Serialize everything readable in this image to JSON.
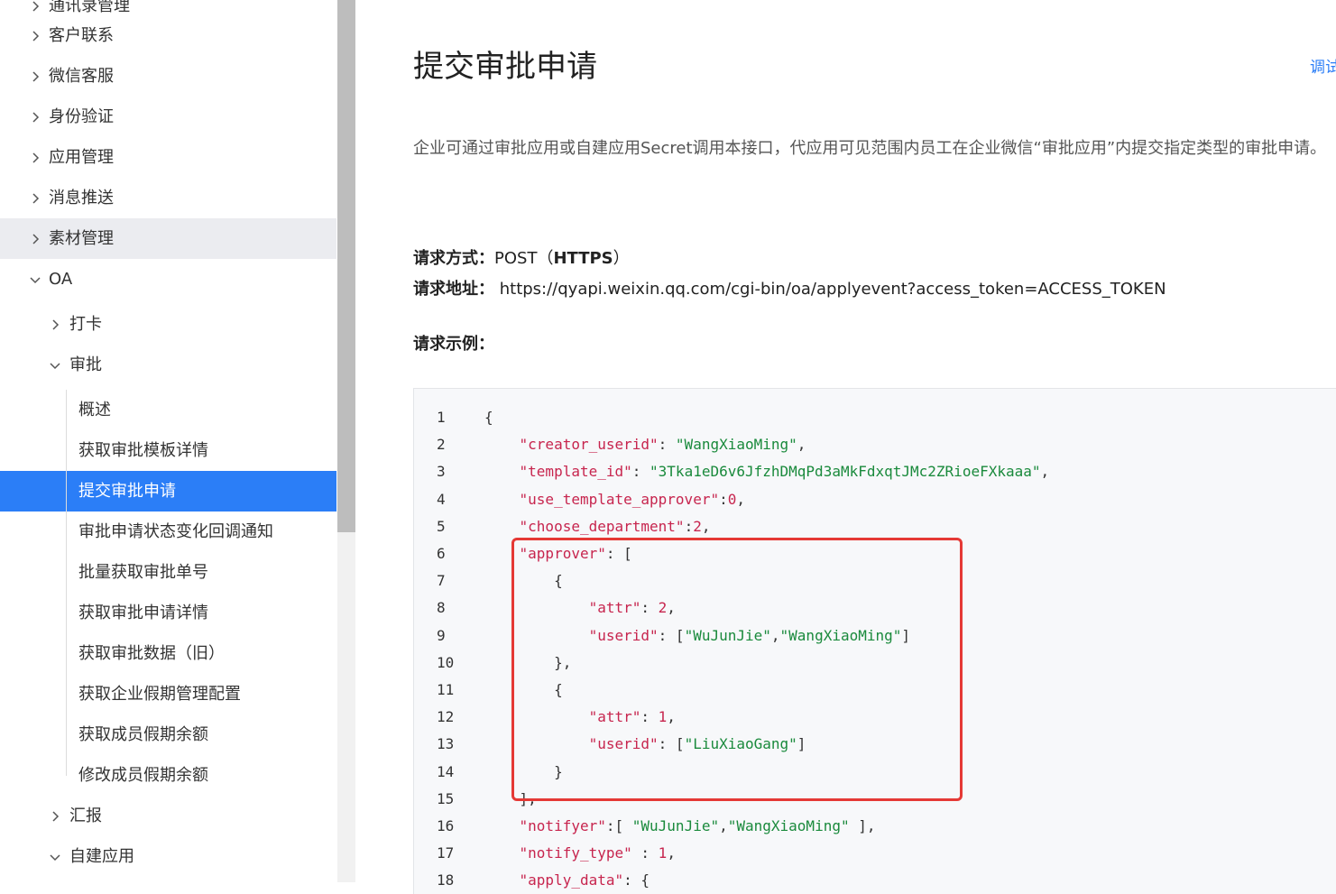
{
  "sidebar": {
    "items": [
      {
        "label": "通讯录管理",
        "level": 1,
        "state": "collapsed"
      },
      {
        "label": "客户联系",
        "level": 1,
        "state": "collapsed"
      },
      {
        "label": "微信客服",
        "level": 1,
        "state": "collapsed"
      },
      {
        "label": "身份验证",
        "level": 1,
        "state": "collapsed"
      },
      {
        "label": "应用管理",
        "level": 1,
        "state": "collapsed"
      },
      {
        "label": "消息推送",
        "level": 1,
        "state": "collapsed"
      },
      {
        "label": "素材管理",
        "level": 1,
        "state": "collapsed"
      },
      {
        "label": "OA",
        "level": 1,
        "state": "expanded"
      },
      {
        "label": "打卡",
        "level": 2,
        "state": "collapsed"
      },
      {
        "label": "审批",
        "level": 2,
        "state": "expanded"
      },
      {
        "label": "概述",
        "level": 3
      },
      {
        "label": "获取审批模板详情",
        "level": 3
      },
      {
        "label": "提交审批申请",
        "level": 3,
        "active": true
      },
      {
        "label": "审批申请状态变化回调通知",
        "level": 3
      },
      {
        "label": "批量获取审批单号",
        "level": 3
      },
      {
        "label": "获取审批申请详情",
        "level": 3
      },
      {
        "label": "获取审批数据（旧）",
        "level": 3
      },
      {
        "label": "获取企业假期管理配置",
        "level": 3
      },
      {
        "label": "获取成员假期余额",
        "level": 3
      },
      {
        "label": "修改成员假期余额",
        "level": 3
      },
      {
        "label": "汇报",
        "level": 2,
        "state": "collapsed"
      },
      {
        "label": "自建应用",
        "level": 2,
        "state": "expanded"
      }
    ]
  },
  "main": {
    "title": "提交审批申请",
    "debug_link": "调试",
    "description": "企业可通过审批应用或自建应用Secret调用本接口，代应用可见范围内员工在企业微信“审批应用”内提交指定类型的审批申请。",
    "method_label": "请求方式：",
    "method_value": "POST（",
    "method_https": "HTTPS",
    "method_close": "）",
    "url_label": "请求地址：",
    "url_value": " https://qyapi.weixin.qq.com/cgi-bin/oa/applyevent?access_token=ACCESS_TOKEN",
    "example_label": "请求示例："
  },
  "code": {
    "lines": [
      {
        "n": "1",
        "segs": [
          {
            "t": "{",
            "c": "p"
          }
        ]
      },
      {
        "n": "2",
        "segs": [
          {
            "t": "    ",
            "c": "p"
          },
          {
            "t": "\"creator_userid\"",
            "c": "k"
          },
          {
            "t": ": ",
            "c": "p"
          },
          {
            "t": "\"WangXiaoMing\"",
            "c": "s"
          },
          {
            "t": ",",
            "c": "p"
          }
        ]
      },
      {
        "n": "3",
        "segs": [
          {
            "t": "    ",
            "c": "p"
          },
          {
            "t": "\"template_id\"",
            "c": "k"
          },
          {
            "t": ": ",
            "c": "p"
          },
          {
            "t": "\"3Tka1eD6v6JfzhDMqPd3aMkFdxqtJMc2ZRioeFXkaaa\"",
            "c": "s"
          },
          {
            "t": ",",
            "c": "p"
          }
        ]
      },
      {
        "n": "4",
        "segs": [
          {
            "t": "    ",
            "c": "p"
          },
          {
            "t": "\"use_template_approver\"",
            "c": "k"
          },
          {
            "t": ":",
            "c": "p"
          },
          {
            "t": "0",
            "c": "n"
          },
          {
            "t": ",",
            "c": "p"
          }
        ]
      },
      {
        "n": "5",
        "segs": [
          {
            "t": "    ",
            "c": "p"
          },
          {
            "t": "\"choose_department\"",
            "c": "k"
          },
          {
            "t": ":",
            "c": "p"
          },
          {
            "t": "2",
            "c": "n"
          },
          {
            "t": ",",
            "c": "p"
          }
        ]
      },
      {
        "n": "6",
        "segs": [
          {
            "t": "    ",
            "c": "p"
          },
          {
            "t": "\"approver\"",
            "c": "k"
          },
          {
            "t": ": [",
            "c": "p"
          }
        ]
      },
      {
        "n": "7",
        "segs": [
          {
            "t": "        {",
            "c": "p"
          }
        ]
      },
      {
        "n": "8",
        "segs": [
          {
            "t": "            ",
            "c": "p"
          },
          {
            "t": "\"attr\"",
            "c": "k"
          },
          {
            "t": ": ",
            "c": "p"
          },
          {
            "t": "2",
            "c": "n"
          },
          {
            "t": ",",
            "c": "p"
          }
        ]
      },
      {
        "n": "9",
        "segs": [
          {
            "t": "            ",
            "c": "p"
          },
          {
            "t": "\"userid\"",
            "c": "k"
          },
          {
            "t": ": [",
            "c": "p"
          },
          {
            "t": "\"WuJunJie\"",
            "c": "s"
          },
          {
            "t": ",",
            "c": "p"
          },
          {
            "t": "\"WangXiaoMing\"",
            "c": "s"
          },
          {
            "t": "]",
            "c": "p"
          }
        ]
      },
      {
        "n": "10",
        "segs": [
          {
            "t": "        },",
            "c": "p"
          }
        ]
      },
      {
        "n": "11",
        "segs": [
          {
            "t": "        {",
            "c": "p"
          }
        ]
      },
      {
        "n": "12",
        "segs": [
          {
            "t": "            ",
            "c": "p"
          },
          {
            "t": "\"attr\"",
            "c": "k"
          },
          {
            "t": ": ",
            "c": "p"
          },
          {
            "t": "1",
            "c": "n"
          },
          {
            "t": ",",
            "c": "p"
          }
        ]
      },
      {
        "n": "13",
        "segs": [
          {
            "t": "            ",
            "c": "p"
          },
          {
            "t": "\"userid\"",
            "c": "k"
          },
          {
            "t": ": [",
            "c": "p"
          },
          {
            "t": "\"LiuXiaoGang\"",
            "c": "s"
          },
          {
            "t": "]",
            "c": "p"
          }
        ]
      },
      {
        "n": "14",
        "segs": [
          {
            "t": "        }",
            "c": "p"
          }
        ]
      },
      {
        "n": "15",
        "segs": [
          {
            "t": "    ],",
            "c": "p"
          }
        ]
      },
      {
        "n": "16",
        "segs": [
          {
            "t": "    ",
            "c": "p"
          },
          {
            "t": "\"notifyer\"",
            "c": "k"
          },
          {
            "t": ":[ ",
            "c": "p"
          },
          {
            "t": "\"WuJunJie\"",
            "c": "s"
          },
          {
            "t": ",",
            "c": "p"
          },
          {
            "t": "\"WangXiaoMing\"",
            "c": "s"
          },
          {
            "t": " ],",
            "c": "p"
          }
        ]
      },
      {
        "n": "17",
        "segs": [
          {
            "t": "    ",
            "c": "p"
          },
          {
            "t": "\"notify_type\"",
            "c": "k"
          },
          {
            "t": " : ",
            "c": "p"
          },
          {
            "t": "1",
            "c": "n"
          },
          {
            "t": ",",
            "c": "p"
          }
        ]
      },
      {
        "n": "18",
        "segs": [
          {
            "t": "    ",
            "c": "p"
          },
          {
            "t": "\"apply_data\"",
            "c": "k"
          },
          {
            "t": ": {",
            "c": "p"
          }
        ]
      }
    ]
  },
  "colors": {
    "accent": "#2b7ef7",
    "highlight_box": "#e53935",
    "json_key": "#c7254e",
    "json_string": "#1a8a3c"
  }
}
